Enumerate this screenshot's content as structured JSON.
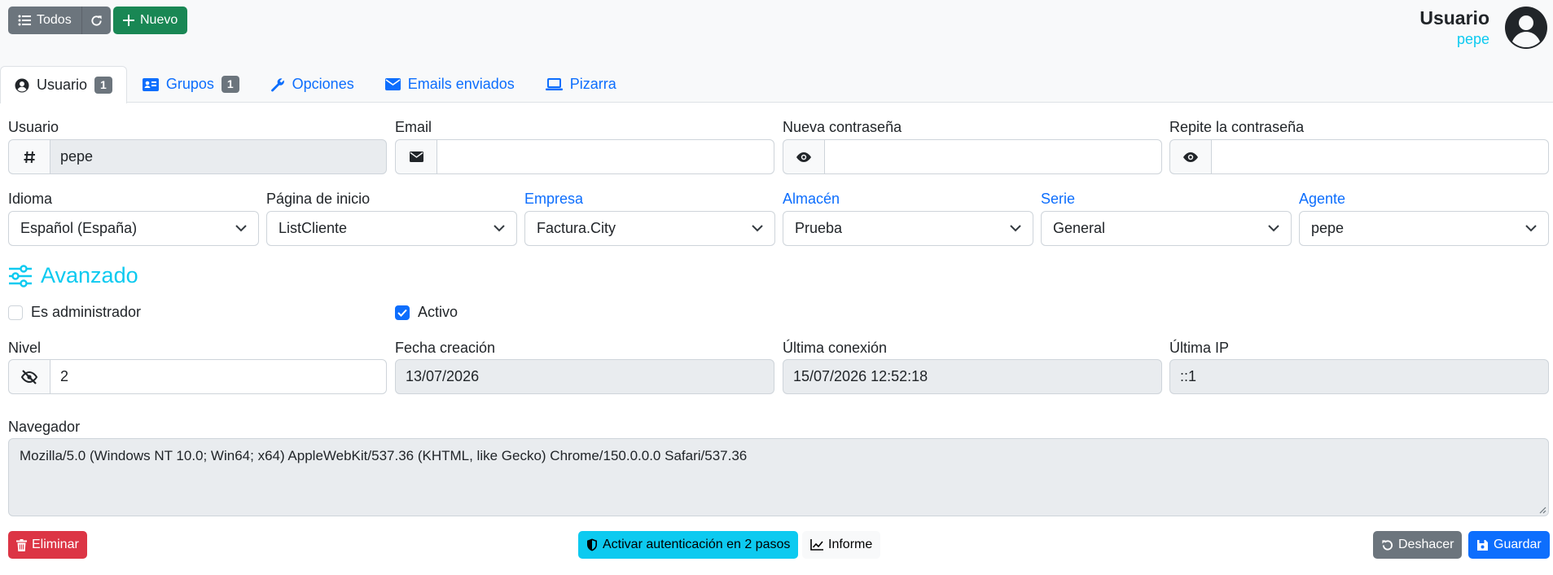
{
  "toolbar": {
    "all_label": "Todos",
    "new_label": "Nuevo"
  },
  "header": {
    "title": "Usuario",
    "subtitle": "pepe"
  },
  "tabs": [
    {
      "label": "Usuario",
      "badge": "1"
    },
    {
      "label": "Grupos",
      "badge": "1"
    },
    {
      "label": "Opciones"
    },
    {
      "label": "Emails enviados"
    },
    {
      "label": "Pizarra"
    }
  ],
  "form": {
    "usuario": {
      "label": "Usuario",
      "value": "pepe"
    },
    "email": {
      "label": "Email",
      "value": ""
    },
    "new_password": {
      "label": "Nueva contraseña",
      "value": ""
    },
    "repeat_password": {
      "label": "Repite la contraseña",
      "value": ""
    },
    "idioma": {
      "label": "Idioma",
      "value": "Español (España)"
    },
    "pagina_inicio": {
      "label": "Página de inicio",
      "value": "ListCliente"
    },
    "empresa": {
      "label": "Empresa",
      "value": "Factura.City"
    },
    "almacen": {
      "label": "Almacén",
      "value": "Prueba"
    },
    "serie": {
      "label": "Serie",
      "value": "General"
    },
    "agente": {
      "label": "Agente",
      "value": "pepe"
    }
  },
  "advanced": {
    "title": "Avanzado",
    "es_admin": {
      "label": "Es administrador",
      "checked": false
    },
    "activo": {
      "label": "Activo",
      "checked": true
    },
    "nivel": {
      "label": "Nivel",
      "value": "2"
    },
    "fecha_creacion": {
      "label": "Fecha creación",
      "value": "13/07/2026"
    },
    "ultima_conexion": {
      "label": "Última conexión",
      "value": "15/07/2026 12:52:18"
    },
    "ultima_ip": {
      "label": "Última IP",
      "value": "::1"
    },
    "navegador": {
      "label": "Navegador",
      "value": "Mozilla/5.0 (Windows NT 10.0; Win64; x64) AppleWebKit/537.36 (KHTML, like Gecko) Chrome/150.0.0.0 Safari/537.36"
    }
  },
  "actions": {
    "delete_label": "Eliminar",
    "twofa_label": "Activar autenticación en 2 pasos",
    "report_label": "Informe",
    "undo_label": "Deshacer",
    "save_label": "Guardar"
  },
  "colors": {
    "primary": "#0d6efd",
    "success": "#198754",
    "danger": "#dc3545",
    "info": "#0dcaf0",
    "secondary": "#6c757d"
  }
}
